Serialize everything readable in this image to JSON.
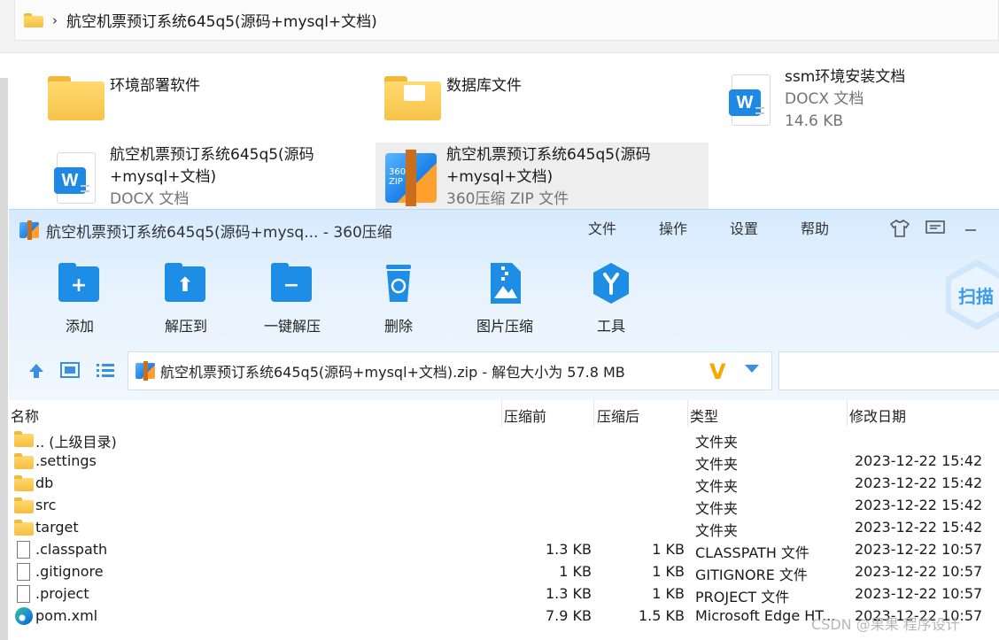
{
  "explorer": {
    "address": "航空机票预订系统645q5(源码+mysql+文档)",
    "tiles": [
      {
        "name": "环境部署软件",
        "type": "",
        "size": "",
        "icon": "folder-icon"
      },
      {
        "name": "数据库文件",
        "type": "",
        "size": "",
        "icon": "folder-doc-icon"
      },
      {
        "name": "ssm环境安装文档",
        "type": "DOCX 文档",
        "size": "14.6 KB",
        "icon": "word-doc-icon"
      },
      {
        "name_line1": "航空机票预订系统645q5(源码",
        "name_line2": "+mysql+文档)",
        "type": "DOCX 文档",
        "icon": "word-doc-icon"
      },
      {
        "name_line1": "航空机票预订系统645q5(源码",
        "name_line2": "+mysql+文档)",
        "type": "360压缩 ZIP 文件",
        "icon": "zip-archive-icon"
      }
    ]
  },
  "zip_window": {
    "title": "航空机票预订系统645q5(源码+mysq... - 360压缩",
    "menu": [
      "文件",
      "操作",
      "设置",
      "帮助"
    ],
    "tools": [
      {
        "label": "添加",
        "icon": "add-icon"
      },
      {
        "label": "解压到",
        "icon": "extract-to-icon"
      },
      {
        "label": "一键解压",
        "icon": "one-click-extract-icon"
      },
      {
        "label": "删除",
        "icon": "delete-icon"
      },
      {
        "label": "图片压缩",
        "icon": "image-compress-icon"
      },
      {
        "label": "工具",
        "icon": "tools-icon"
      }
    ],
    "scan_label": "扫描",
    "path_text": "航空机票预订系统645q5(源码+mysql+文档).zip - 解包大小为 57.8 MB",
    "columns": {
      "name": "名称",
      "compressed_before": "压缩前",
      "compressed_after": "压缩后",
      "type": "类型",
      "modified": "修改日期"
    },
    "rows": [
      {
        "name": ".. (上级目录)",
        "before": "",
        "after": "",
        "type": "文件夹",
        "date": "",
        "icon": "folder"
      },
      {
        "name": ".settings",
        "before": "",
        "after": "",
        "type": "文件夹",
        "date": "2023-12-22 15:42",
        "icon": "folder"
      },
      {
        "name": "db",
        "before": "",
        "after": "",
        "type": "文件夹",
        "date": "2023-12-22 15:42",
        "icon": "folder"
      },
      {
        "name": "src",
        "before": "",
        "after": "",
        "type": "文件夹",
        "date": "2023-12-22 15:42",
        "icon": "folder"
      },
      {
        "name": "target",
        "before": "",
        "after": "",
        "type": "文件夹",
        "date": "2023-12-22 15:42",
        "icon": "folder"
      },
      {
        "name": ".classpath",
        "before": "1.3 KB",
        "after": "1 KB",
        "type": "CLASSPATH 文件",
        "date": "2023-12-22 10:57",
        "icon": "file"
      },
      {
        "name": ".gitignore",
        "before": "1 KB",
        "after": "1 KB",
        "type": "GITIGNORE 文件",
        "date": "2023-12-22 10:57",
        "icon": "file"
      },
      {
        "name": ".project",
        "before": "1.3 KB",
        "after": "1 KB",
        "type": "PROJECT 文件",
        "date": "2023-12-22 10:57",
        "icon": "file"
      },
      {
        "name": "pom.xml",
        "before": "7.9 KB",
        "after": "1.5 KB",
        "type": "Microsoft Edge HT...",
        "date": "2023-12-22 10:57",
        "icon": "edge"
      }
    ]
  },
  "watermark": "CSDN @果果 程序设计"
}
